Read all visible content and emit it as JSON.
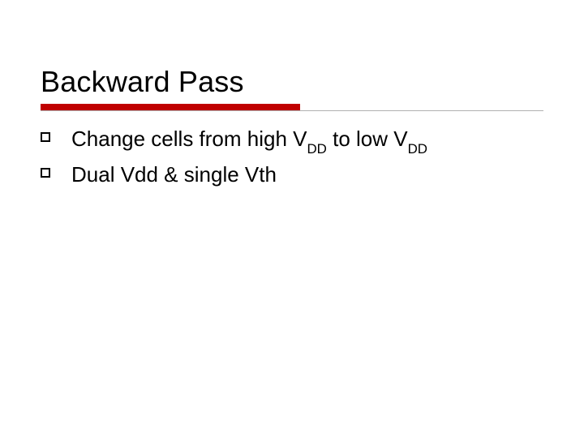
{
  "title": "Backward Pass",
  "bullets": [
    {
      "pre": "Change cells from high V",
      "sub1": "DD",
      "mid": " to low V",
      "sub2": "DD",
      "post": ""
    },
    {
      "pre": "Dual Vdd & single Vth",
      "sub1": "",
      "mid": "",
      "sub2": "",
      "post": ""
    }
  ]
}
